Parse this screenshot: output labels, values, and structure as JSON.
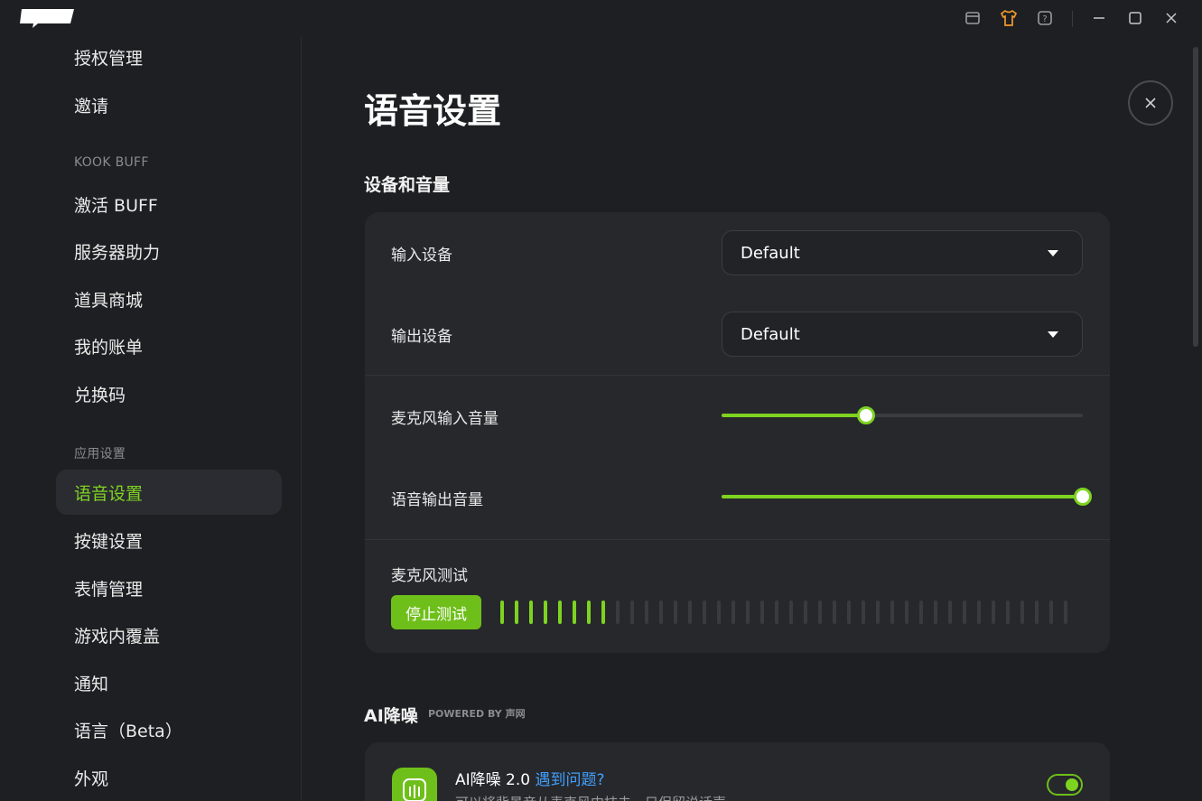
{
  "app": {
    "logo_text": "KOOK"
  },
  "titlebar": {
    "icons": [
      "shop-icon",
      "shirt-icon",
      "help-icon",
      "minimize-icon",
      "maximize-icon",
      "close-icon"
    ]
  },
  "sidebar": {
    "items_top": [
      {
        "label": "授权管理"
      },
      {
        "label": "邀请"
      }
    ],
    "group_buff": "KOOK BUFF",
    "items_buff": [
      {
        "label": "激活 BUFF"
      },
      {
        "label": "服务器助力"
      },
      {
        "label": "道具商城"
      },
      {
        "label": "我的账单"
      },
      {
        "label": "兑换码"
      }
    ],
    "group_app": "应用设置",
    "items_app": [
      {
        "label": "语音设置",
        "active": true
      },
      {
        "label": "按键设置"
      },
      {
        "label": "表情管理"
      },
      {
        "label": "游戏内覆盖"
      },
      {
        "label": "通知"
      },
      {
        "label": "语言（Beta）"
      },
      {
        "label": "外观"
      }
    ]
  },
  "main": {
    "title": "语音设置",
    "section_devices": "设备和音量",
    "input_device_label": "输入设备",
    "input_device_value": "Default",
    "output_device_label": "输出设备",
    "output_device_value": "Default",
    "mic_volume_label": "麦克风输入音量",
    "mic_volume": 0.4,
    "output_volume_label": "语音输出音量",
    "output_volume": 1.0,
    "mic_test_label": "麦克风测试",
    "mic_test_button": "停止测试",
    "meter_total_bars": 40,
    "meter_active_bars": 8,
    "ai_section_title": "AI降噪",
    "ai_powered_by": "POWERED BY 声网",
    "ai_name": "AI降噪 2.0",
    "ai_link": "遇到问题?",
    "ai_desc": "可以将背景音从麦克风中抹去，只保留说话声",
    "ai_enabled": true
  },
  "colors": {
    "accent": "#7ed321",
    "background": "#1e1f22",
    "card": "#27282c"
  }
}
